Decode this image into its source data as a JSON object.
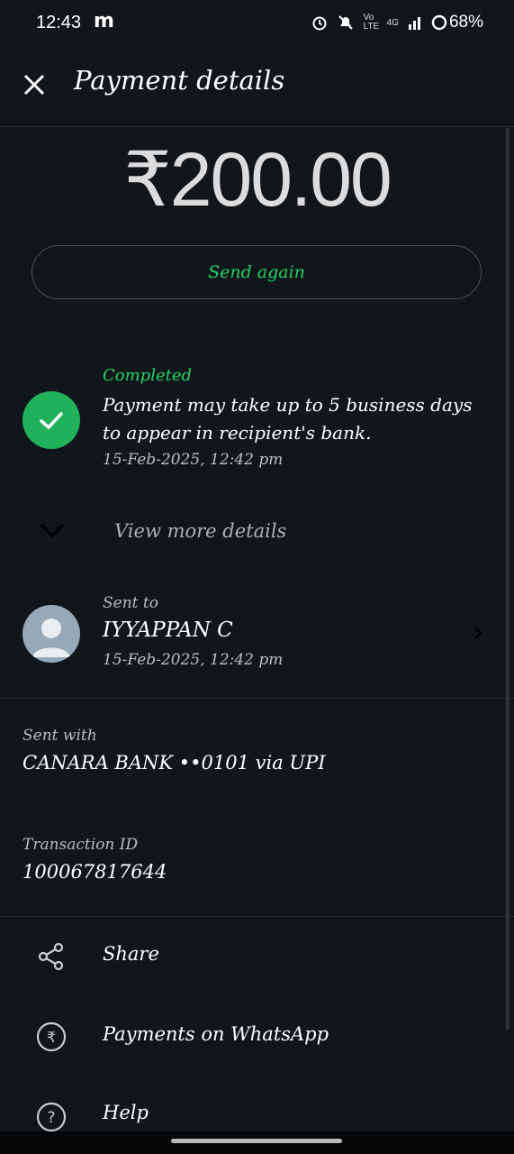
{
  "status_bar": {
    "time": "12:43",
    "notification_letter": "m",
    "volte": "Vo LTE",
    "network": "4G",
    "battery": "68%"
  },
  "header": {
    "title": "Payment details"
  },
  "payment": {
    "amount": "₹200.00",
    "send_again_label": "Send again",
    "status": "Completed",
    "status_message": "Payment may take up to 5 business days to appear in recipient's bank.",
    "timestamp": "15-Feb-2025, 12:42 pm",
    "view_more_label": "View more details"
  },
  "recipient": {
    "label": "Sent to",
    "name": "IYYAPPAN C",
    "timestamp": "15-Feb-2025, 12:42 pm"
  },
  "sent_with": {
    "label": "Sent with",
    "value": "CANARA BANK ••0101 via UPI"
  },
  "transaction": {
    "label": "Transaction ID",
    "value": "100067817644"
  },
  "actions": [
    {
      "label": "Share",
      "icon": "share-icon"
    },
    {
      "label": "Payments on WhatsApp",
      "icon": "rupee-icon"
    },
    {
      "label": "Help",
      "icon": "help-icon"
    }
  ],
  "colors": {
    "background": "#11161b",
    "accent_green": "#25d366",
    "success_circle": "#21b15b"
  }
}
